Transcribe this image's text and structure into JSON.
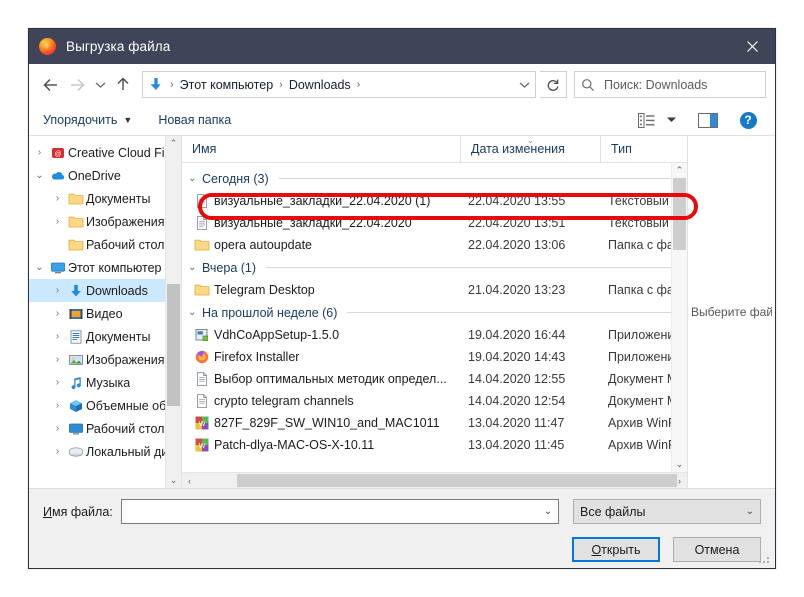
{
  "window": {
    "title": "Выгрузка файла",
    "close_label": "✕"
  },
  "nav": {
    "back": "←",
    "forward": "→",
    "recent": "˅",
    "up": "↑",
    "breadcrumb": [
      "Этот компьютер",
      "Downloads"
    ],
    "breadcrumb_sep": "›",
    "crumb_dropdown": "˅",
    "refresh": "↻",
    "search_placeholder": "Поиск: Downloads"
  },
  "toolbar": {
    "organize": "Упорядочить",
    "organize_caret": "▼",
    "new_folder": "Новая папка",
    "view_caret": "▼",
    "help": "?"
  },
  "sidebar": {
    "items": [
      {
        "label": "Creative Cloud Fil",
        "icon": "creative-cloud-icon",
        "chevron": "›",
        "indent": 0,
        "selected": false
      },
      {
        "label": "OneDrive",
        "icon": "onedrive-cloud-icon",
        "chevron": "⌄",
        "indent": 0,
        "selected": false
      },
      {
        "label": "Документы",
        "icon": "folder-icon",
        "chevron": "›",
        "indent": 1,
        "selected": false
      },
      {
        "label": "Изображения",
        "icon": "folder-icon",
        "chevron": "›",
        "indent": 1,
        "selected": false
      },
      {
        "label": "Рабочий стол",
        "icon": "folder-icon",
        "chevron": "",
        "indent": 1,
        "selected": false
      },
      {
        "label": "Этот компьютер",
        "icon": "this-pc-icon",
        "chevron": "⌄",
        "indent": 0,
        "selected": false
      },
      {
        "label": "Downloads",
        "icon": "downloads-icon",
        "chevron": "›",
        "indent": 1,
        "selected": true
      },
      {
        "label": "Видео",
        "icon": "videos-icon",
        "chevron": "›",
        "indent": 1,
        "selected": false
      },
      {
        "label": "Документы",
        "icon": "documents-icon",
        "chevron": "›",
        "indent": 1,
        "selected": false
      },
      {
        "label": "Изображения",
        "icon": "pictures-icon",
        "chevron": "›",
        "indent": 1,
        "selected": false
      },
      {
        "label": "Музыка",
        "icon": "music-icon",
        "chevron": "›",
        "indent": 1,
        "selected": false
      },
      {
        "label": "Объемные объе",
        "icon": "3d-objects-icon",
        "chevron": "›",
        "indent": 1,
        "selected": false
      },
      {
        "label": "Рабочий стол",
        "icon": "desktop-icon",
        "chevron": "›",
        "indent": 1,
        "selected": false
      },
      {
        "label": "Локальный дис",
        "icon": "local-disk-icon",
        "chevron": "›",
        "indent": 1,
        "selected": false
      }
    ],
    "scroll_up": "⌃",
    "scroll_down": "⌄"
  },
  "columns": {
    "name": "Имя",
    "date": "Дата изменения",
    "type": "Тип",
    "sort_mark": "⌄"
  },
  "groups": [
    {
      "label": "Сегодня (3)",
      "chevron": "⌄",
      "rows": [
        {
          "name": "визуальные_закладки_22.04.2020 (1)",
          "date": "22.04.2020 13:55",
          "type": "Текстовый д",
          "icon": "text-file-icon"
        },
        {
          "name": "визуальные_закладки_22.04.2020",
          "date": "22.04.2020 13:51",
          "type": "Текстовый д",
          "icon": "text-file-icon"
        },
        {
          "name": "opera autoupdate",
          "date": "22.04.2020 13:06",
          "type": "Папка с фай",
          "icon": "folder-icon"
        }
      ]
    },
    {
      "label": "Вчера (1)",
      "chevron": "⌄",
      "rows": [
        {
          "name": "Telegram Desktop",
          "date": "21.04.2020 13:23",
          "type": "Папка с фай",
          "icon": "folder-icon"
        }
      ]
    },
    {
      "label": "На прошлой неделе (6)",
      "chevron": "⌄",
      "rows": [
        {
          "name": "VdhCoAppSetup-1.5.0",
          "date": "19.04.2020 16:44",
          "type": "Приложени",
          "icon": "installer-icon"
        },
        {
          "name": "Firefox Installer",
          "date": "19.04.2020 14:43",
          "type": "Приложени",
          "icon": "firefox-icon"
        },
        {
          "name": "Выбор оптимальных методик определ...",
          "date": "14.04.2020 12:55",
          "type": "Документ M",
          "icon": "word-doc-icon"
        },
        {
          "name": "crypto telegram channels",
          "date": "14.04.2020 12:54",
          "type": "Документ M",
          "icon": "word-doc-icon"
        },
        {
          "name": "827F_829F_SW_WIN10_and_MAC1011",
          "date": "13.04.2020 11:47",
          "type": "Архив WinRA",
          "icon": "winrar-icon"
        },
        {
          "name": "Patch-dlya-MAC-OS-X-10.11",
          "date": "13.04.2020 11:45",
          "type": "Архив WinRA",
          "icon": "winrar-icon"
        }
      ]
    }
  ],
  "scroll": {
    "left_arrow": "‹",
    "right_arrow": "›",
    "up_arrow": "⌃",
    "down_arrow": "⌄"
  },
  "preview": {
    "text": "Выберите файл для предварительного просмотра."
  },
  "footer": {
    "file_name_label_accel": "И",
    "file_name_label_rest": "мя файла:",
    "file_name_value": "",
    "file_name_arrow": "⌄",
    "filter_value": "Все файлы",
    "filter_arrow": "⌄",
    "open_accel": "О",
    "open_rest": "ткрыть",
    "cancel": "Отмена"
  },
  "annotation": {
    "color": "#e8090c"
  }
}
